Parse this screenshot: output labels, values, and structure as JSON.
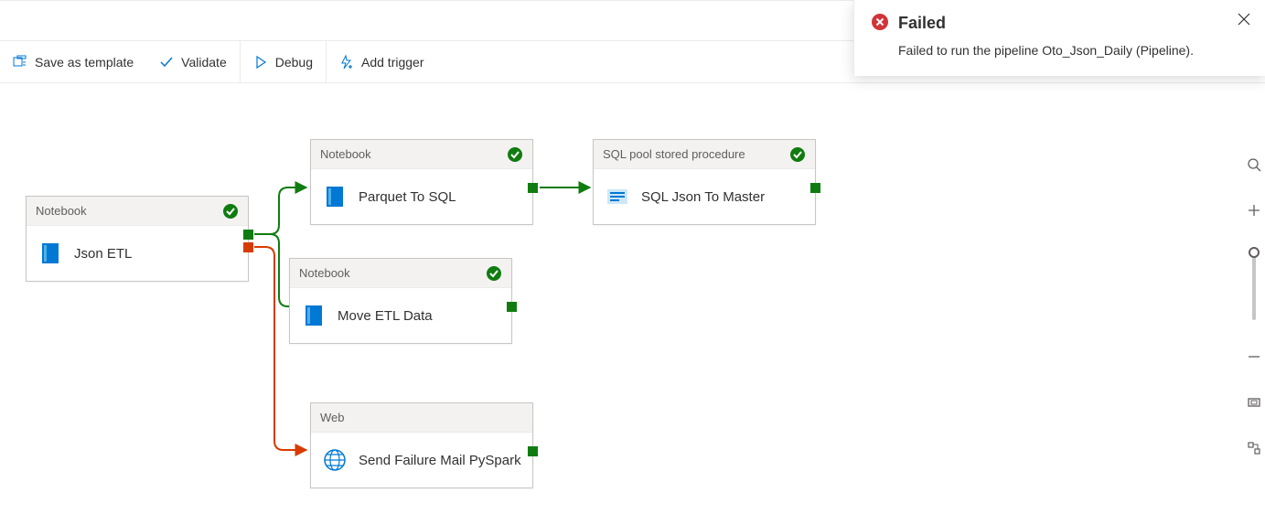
{
  "toolbar": {
    "save_template": "Save as template",
    "validate": "Validate",
    "debug": "Debug",
    "add_trigger": "Add trigger"
  },
  "activities": {
    "json_etl": {
      "type": "Notebook",
      "title": "Json ETL",
      "status": "succeeded"
    },
    "parquet_to_sql": {
      "type": "Notebook",
      "title": "Parquet To SQL",
      "status": "succeeded"
    },
    "move_etl_data": {
      "type": "Notebook",
      "title": "Move ETL Data",
      "status": "succeeded"
    },
    "sql_json_master": {
      "type": "SQL pool stored procedure",
      "title": "SQL Json To Master",
      "status": "succeeded"
    },
    "send_failure_mail": {
      "type": "Web",
      "title": "Send Failure Mail PySpark",
      "status": "none"
    }
  },
  "notification": {
    "title": "Failed",
    "message": "Failed to run the pipeline Oto_Json_Daily (Pipeline)."
  },
  "colors": {
    "success_green": "#107c10",
    "fail_red": "#d13438",
    "fail_orange": "#d83b01",
    "icon_blue": "#0078d4",
    "icon_light_blue": "#50b0e8"
  }
}
